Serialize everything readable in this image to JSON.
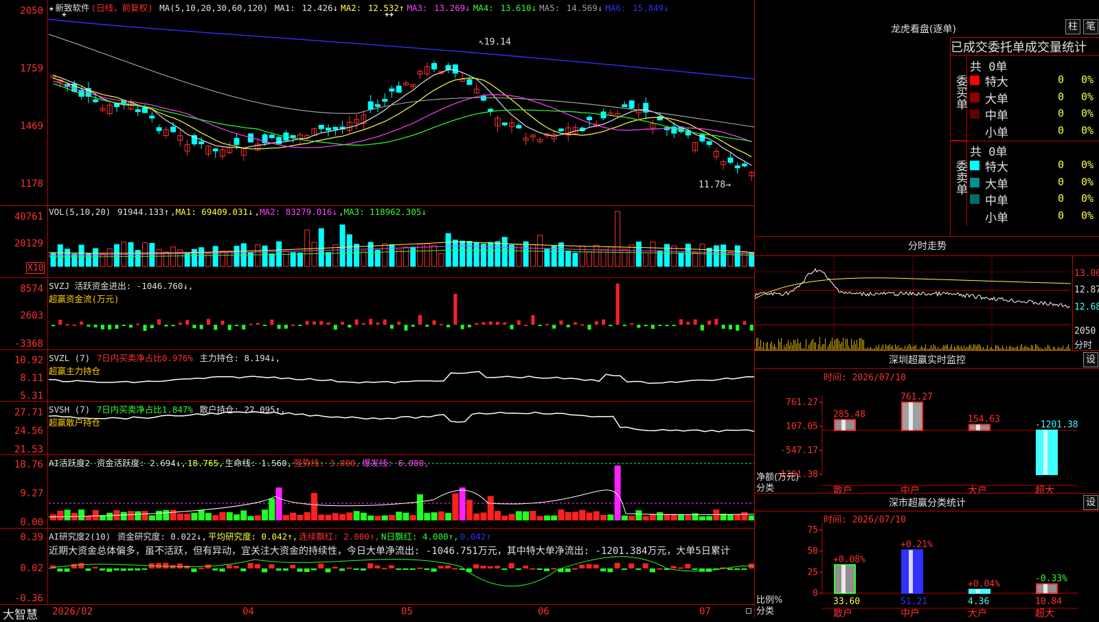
{
  "stock": {
    "name": "新致软件",
    "mode": "(日线，前复权)",
    "ma_header": "MA(5,10,20,30,60,120)",
    "ma": [
      {
        "label": "MA1:",
        "value": "12.426↓",
        "color": "#e0e0e0"
      },
      {
        "label": "MA2:",
        "value": "12.532↑",
        "color": "#ffff40"
      },
      {
        "label": "MA3:",
        "value": "13.269↓",
        "color": "#ff40ff"
      },
      {
        "label": "MA4:",
        "value": "13.610↓",
        "color": "#30ff30"
      },
      {
        "label": "MA5:",
        "value": "14.569↓",
        "color": "#a0a0a0"
      },
      {
        "label": "MA6:",
        "value": "15.849↓",
        "color": "#3030ff"
      }
    ],
    "price_axis": [
      "2050",
      "1759",
      "1469",
      "1178"
    ],
    "high_label": "19.14",
    "low_label": "11.78"
  },
  "vol": {
    "header_name": "VOL(5,10,20)",
    "value": "91944.133↑",
    "ma1": "MA1: 69409.031↓",
    "ma2": "MA2: 83279.016↓",
    "ma3": "MA3: 118962.305↓",
    "axis": [
      "40761",
      "20129"
    ],
    "unit": "X10"
  },
  "svzj": {
    "header": "SVZJ  活跃资金进出: -1046.760↓,",
    "sub": "超赢资金流(万元)",
    "axis": [
      "8574",
      "2603",
      "-3368"
    ]
  },
  "svzl": {
    "name": "SVZL (7)",
    "ratio": "7日内买卖净占比0.976%",
    "hold": "主力持仓: 8.194↓,",
    "sub": "超赢主力持仓",
    "axis": [
      "10.92",
      "8.11",
      "5.31"
    ]
  },
  "svsh": {
    "name": "SVSH (7)",
    "ratio": "7日内买卖净占比1.847%",
    "hold": "散户持仓: 22.095↑,",
    "sub": "超赢散户持仓",
    "axis": [
      "27.71",
      "24.56",
      "21.53"
    ]
  },
  "ai_active": {
    "name": "AI活跃度2",
    "v1": "资金活跃度: 2.694↓,",
    "v2": "18.765,",
    "v3": "生命线: 1.560,",
    "v4": "强势线: 3.000,",
    "v5": "爆发线: 6.000,",
    "axis": [
      "18.76",
      "9.27",
      "0.00"
    ]
  },
  "ai_research": {
    "name": "AI研究度2(10)",
    "v1": "资金研究度: 0.022↓,",
    "v2": "平均研究度: 0.042↑,",
    "v3": "连续飘红: 2.000↑,",
    "v4": "N日飘红: 4.000↑,",
    "v5": "0.042↑",
    "text": "近期大资金总体偏多，虽不活跃，但有异动，宜关注大资金的持续性，今日大单净流出: -1046.751万元，其中特大单净流出: -1201.384万元，大单5日累计",
    "axis": [
      "0.39",
      "0.02",
      "-0.36"
    ]
  },
  "bottom": {
    "brand": "大智慧",
    "dates": [
      "2026/02",
      "04",
      "05",
      "06",
      "07"
    ]
  },
  "dragon": {
    "title": "龙虎看盘(逐单)",
    "btn1": "柱",
    "btn2": "笔",
    "table_title": "已成交委托单成交量统计",
    "buy_label": "委买单",
    "sell_label": "委卖单",
    "buy_total": "共 0单",
    "sell_total": "共 0单",
    "buy_rows": [
      {
        "label": "特大",
        "count": "0",
        "pct": "0%",
        "color": "#ff0000"
      },
      {
        "label": "大单",
        "count": "0",
        "pct": "0%",
        "color": "#900000"
      },
      {
        "label": "中单",
        "count": "0",
        "pct": "0%",
        "color": "#600000"
      },
      {
        "label": "小单",
        "count": "0",
        "pct": "0%",
        "color": "#000000"
      }
    ],
    "sell_rows": [
      {
        "label": "特大",
        "count": "0",
        "pct": "0%",
        "color": "#00ffff"
      },
      {
        "label": "大单",
        "count": "0",
        "pct": "0%",
        "color": "#009090"
      },
      {
        "label": "中单",
        "count": "0",
        "pct": "0%",
        "color": "#006a6a"
      },
      {
        "label": "小单",
        "count": "0",
        "pct": "0%",
        "color": "#000000"
      }
    ]
  },
  "intraday": {
    "title": "分时走势",
    "axis": [
      "13.06",
      "12.87",
      "12.68"
    ],
    "vol_axis": "2050",
    "vol_unit": "分时"
  },
  "sz_monitor": {
    "title": "深圳超赢实时监控",
    "set_btn": "设",
    "time": "时间: 2026/07/10",
    "axis": [
      "761.27",
      "107.05",
      "-547.17",
      "-1201.38"
    ],
    "axis_title1": "净额(万元)",
    "axis_title2": "分类",
    "categories": [
      "散户",
      "中户",
      "大户",
      "超大"
    ],
    "chart_data": {
      "type": "bar",
      "categories": [
        "散户",
        "中户",
        "大户",
        "超大"
      ],
      "values": [
        285.48,
        761.27,
        154.63,
        -1201.38
      ],
      "value_labels": [
        "285.48",
        "761.27",
        "154.63",
        "-1201.38"
      ],
      "ylim": [
        -1201.38,
        761.27
      ]
    }
  },
  "sz_class": {
    "title": "深市超赢分类统计",
    "set_btn": "设",
    "time": "时间: 2026/07/10",
    "axis": [
      "75",
      "50",
      "25",
      "0"
    ],
    "axis_title1": "比例%",
    "axis_title2": "分类",
    "categories": [
      "散户",
      "中户",
      "大户",
      "超大"
    ],
    "chart_data": {
      "type": "bar",
      "categories": [
        "散户",
        "中户",
        "大户",
        "超大"
      ],
      "values": [
        33.6,
        51.21,
        4.36,
        10.84
      ],
      "value_labels": [
        "33.60",
        "51.21",
        "4.36",
        "10.84"
      ],
      "change_labels": [
        "+0.08%",
        "+0.21%",
        "+0.04%",
        "-0.33%"
      ],
      "ylim": [
        0,
        75
      ]
    }
  }
}
